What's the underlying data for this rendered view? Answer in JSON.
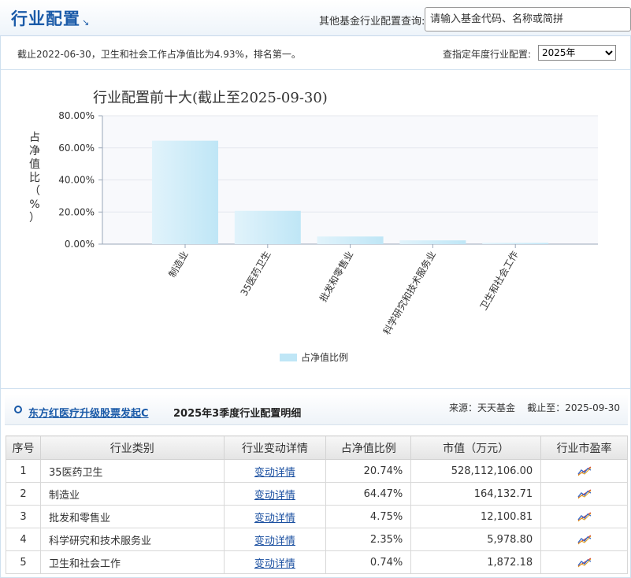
{
  "header": {
    "title": "行业配置",
    "query_label": "其他基金行业配置查询:",
    "query_placeholder": "请输入基金代码、名称或简拼"
  },
  "info": {
    "summary": "截止2022-06-30，卫生和社会工作占净值比为4.93%，排名第一。",
    "year_label": "查指定年度行业配置:",
    "year_selected": "2025年"
  },
  "chart_data": {
    "type": "bar",
    "title": "行业配置前十大(截止至2025-09-30)",
    "ylabel": "占净值比（%）",
    "ylim": [
      0,
      80
    ],
    "yticks": [
      "0.00%",
      "20.00%",
      "40.00%",
      "60.00%",
      "80.00%"
    ],
    "categories": [
      "制造业",
      "35医药卫生",
      "批发和零售业",
      "科学研究和技术服务业",
      "卫生和社会工作"
    ],
    "series": [
      {
        "name": "占净值比例",
        "values": [
          64.47,
          20.74,
          4.75,
          2.35,
          0.74
        ]
      }
    ],
    "grid": true,
    "legend": "bottom-center",
    "bar_color": "#bfe6f6"
  },
  "detail": {
    "fund_name": "东方红医疗升级股票发起C",
    "section_title": "2025年3季度行业配置明细",
    "source": "来源：天天基金    截止至：2025-09-30",
    "columns": [
      "序号",
      "行业类别",
      "行业变动详情",
      "占净值比例",
      "市值（万元）",
      "行业市盈率"
    ],
    "rows": [
      {
        "idx": "1",
        "name": "35医药卫生",
        "detail": "变动详情",
        "ratio": "20.74%",
        "value": "528,112,106.00"
      },
      {
        "idx": "2",
        "name": "制造业",
        "detail": "变动详情",
        "ratio": "64.47%",
        "value": "164,132.71"
      },
      {
        "idx": "3",
        "name": "批发和零售业",
        "detail": "变动详情",
        "ratio": "4.75%",
        "value": "12,100.81"
      },
      {
        "idx": "4",
        "name": "科学研究和技术服务业",
        "detail": "变动详情",
        "ratio": "2.35%",
        "value": "5,978.80"
      },
      {
        "idx": "5",
        "name": "卫生和社会工作",
        "detail": "变动详情",
        "ratio": "0.74%",
        "value": "1,872.18"
      }
    ],
    "pe_icon": "trend-chart-icon"
  }
}
